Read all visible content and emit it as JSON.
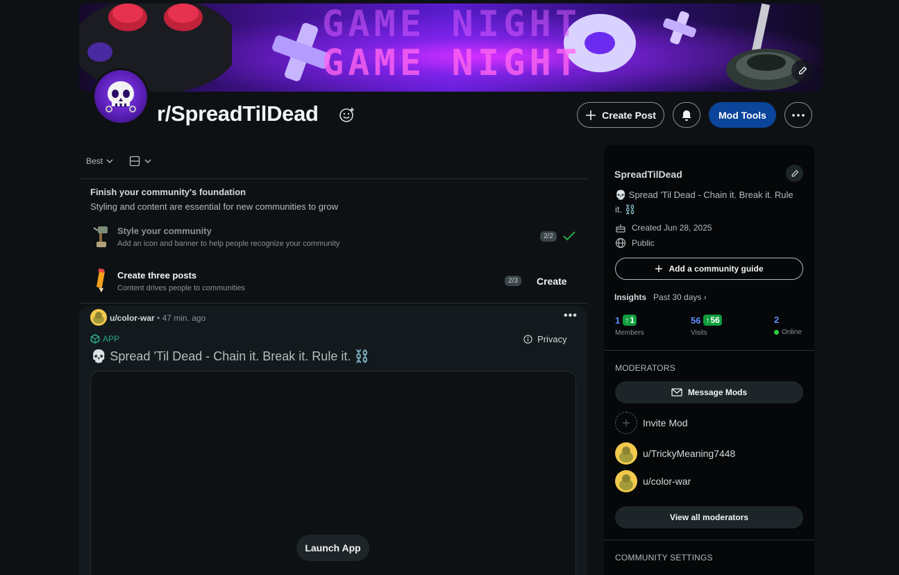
{
  "banner": {
    "text_line1": "GAME NIGHT",
    "text_line2": "GAME NIGHT"
  },
  "community": {
    "title": "r/SpreadTilDead",
    "actions": {
      "create_post": "Create Post",
      "mod_tools": "Mod Tools"
    }
  },
  "feed": {
    "sort_label": "Best"
  },
  "foundation": {
    "title": "Finish your community's foundation",
    "subtitle": "Styling and content are essential for new communities to grow",
    "tasks": [
      {
        "title": "Style your community",
        "subtitle": "Add an icon and banner to help people recognize your community",
        "progress": "2/2",
        "done": true
      },
      {
        "title": "Create three posts",
        "subtitle": "Content drives people to communities",
        "progress": "2/3",
        "action": "Create"
      }
    ]
  },
  "post": {
    "author": "u/color-war",
    "time": "• 47 min. ago",
    "app_tag": "APP",
    "privacy": "Privacy",
    "title": "💀 Spread 'Til Dead - Chain it. Break it. Rule it. ⛓️",
    "launch": "Launch App"
  },
  "sidebar": {
    "name": "SpreadTilDead",
    "description": "💀 Spread 'Til Dead - Chain it. Break it. Rule it. ⛓️",
    "created": "Created Jun 28, 2025",
    "visibility": "Public",
    "guide_button": "Add a community guide",
    "insights_label": "Insights",
    "insights_period": "Past 30 days",
    "stats": [
      {
        "value": "1",
        "delta": "1",
        "label": "Members"
      },
      {
        "value": "56",
        "delta": "56",
        "label": "Visits"
      },
      {
        "value": "2",
        "label": "Online"
      }
    ],
    "moderators_heading": "MODERATORS",
    "message_mods": "Message Mods",
    "invite_mod": "Invite Mod",
    "moderators": [
      "u/TrickyMeaning7448",
      "u/color-war"
    ],
    "view_all": "View all moderators",
    "settings_heading": "COMMUNITY SETTINGS"
  },
  "colors": {
    "background": "#0e1113",
    "mod_tools_bg": "#0a449b",
    "stat_value": "#648efc",
    "stat_up": "#0f9d3e",
    "app_tag": "#2aa88a"
  }
}
